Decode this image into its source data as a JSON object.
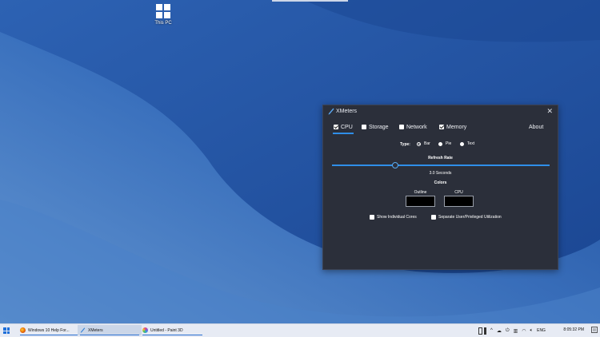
{
  "desktop": {
    "icon_label": "This PC"
  },
  "window": {
    "title": "XMeters",
    "close_glyph": "✕",
    "tabs": [
      {
        "label": "CPU",
        "checked": true,
        "active": true
      },
      {
        "label": "Storage",
        "checked": false,
        "active": false
      },
      {
        "label": "Network",
        "checked": false,
        "active": false
      },
      {
        "label": "Memory",
        "checked": true,
        "active": false
      }
    ],
    "about_label": "About",
    "type_label": "Type:",
    "type_options": [
      {
        "label": "Bar",
        "selected": true
      },
      {
        "label": "Pie",
        "selected": false
      },
      {
        "label": "Text",
        "selected": false
      }
    ],
    "refresh_heading": "Refresh Rate",
    "refresh_fraction": 0.29,
    "refresh_value": "3.0 Seconds",
    "colors_heading": "Colors",
    "color_outline_label": "Outline",
    "color_cpu_label": "CPU",
    "color_outline_value": "#000000",
    "color_cpu_value": "#000000",
    "option_individual_cores": "Show Individual Cores",
    "option_separate_utilization": "Separate User/Privileged Utilization",
    "accent": "#2f8ee8"
  },
  "taskbar": {
    "items": [
      {
        "label": "Windows 10 Help For...",
        "icon": "firefox-icon"
      },
      {
        "label": "XMeters",
        "icon": "xmeters-icon"
      },
      {
        "label": "Untitled - Paint 3D",
        "icon": "paint3d-icon"
      }
    ],
    "language": "ENG",
    "time": "8:05:32 PM"
  }
}
